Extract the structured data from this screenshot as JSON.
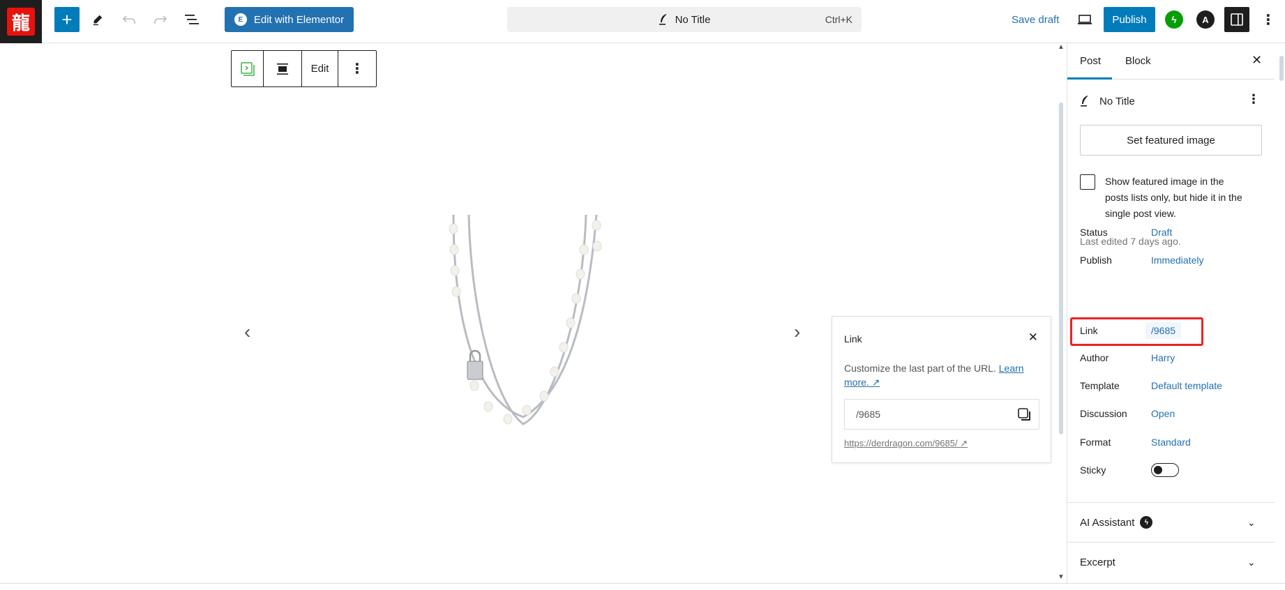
{
  "header": {
    "logo_glyph": "龍",
    "add_block_label": "+",
    "elementor_label": "Edit with Elementor",
    "elementor_logo": "E",
    "command_title": "No Title",
    "command_shortcut": "Ctrl+K",
    "save_draft_label": "Save draft",
    "publish_label": "Publish",
    "jetpack_glyph": "ϟ",
    "astra_glyph": "A",
    "more_glyph": "⋮"
  },
  "block_toolbar": {
    "edit_label": "Edit",
    "more_glyph": "⋮"
  },
  "slider": {
    "prev_glyph": "‹",
    "next_glyph": "›"
  },
  "link_popover": {
    "title": "Link",
    "close_glyph": "✕",
    "description": "Customize the last part of the URL.",
    "learn_more": "Learn more. ↗",
    "slug_value": "/9685",
    "permalink": "https://derdragon.com/9685/ ↗"
  },
  "sidebar": {
    "tabs": [
      {
        "label": "Post",
        "active": true
      },
      {
        "label": "Block",
        "active": false
      }
    ],
    "close_glyph": "✕",
    "post_title": "No Title",
    "more_glyph": "⋮",
    "featured_image_label": "Set featured image",
    "featured_checkbox_label": "Show featured image in the posts lists only, but hide it in the single post view.",
    "featured_checkbox_checked": false,
    "last_edited": "Last edited 7 days ago.",
    "rows": [
      {
        "label": "Status",
        "value": "Draft"
      },
      {
        "label": "Publish",
        "value": "Immediately"
      },
      {
        "label": "Link",
        "value": "/9685"
      },
      {
        "label": "Author",
        "value": "Harry"
      },
      {
        "label": "Template",
        "value": "Default template"
      },
      {
        "label": "Discussion",
        "value": "Open"
      },
      {
        "label": "Format",
        "value": "Standard"
      },
      {
        "label": "Sticky",
        "value": ""
      }
    ],
    "sticky_on": false,
    "panels": [
      {
        "label": "AI Assistant",
        "badge": "ϟ"
      },
      {
        "label": "Excerpt"
      }
    ],
    "chevron_glyph": "⌄"
  },
  "colors": {
    "accent": "#007cba",
    "link": "#2271b1",
    "elementor": "#2271b1",
    "highlight_box": "#ec2222",
    "jetpack": "#069e08"
  }
}
